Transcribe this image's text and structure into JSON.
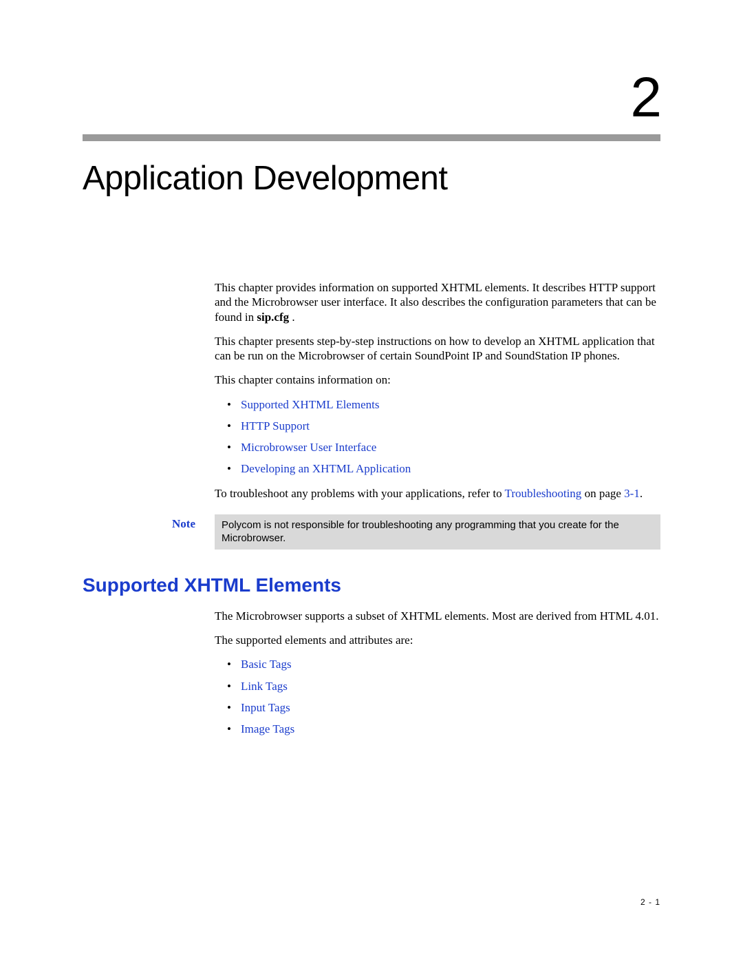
{
  "chapter": {
    "number": "2",
    "title": "Application Development"
  },
  "intro": {
    "p1_a": "This chapter provides information on supported XHTML elements. It describes HTTP support and the Microbrowser user interface. It also describes the configuration parameters that can be found in ",
    "p1_bold": "sip.cfg",
    "p1_b": " .",
    "p2": "This chapter presents step-by-step instructions on how to develop an XHTML application that can be run on the Microbrowser of certain SoundPoint IP and SoundStation IP phones.",
    "p3": "This chapter contains information on:",
    "bullets": [
      "Supported XHTML Elements",
      "HTTP Support",
      "Microbrowser User Interface",
      "Developing an XHTML Application"
    ],
    "p4_a": "To troubleshoot any problems with your applications, refer to ",
    "p4_link": "Troubleshooting",
    "p4_b": " on page ",
    "p4_page": "3-1",
    "p4_c": "."
  },
  "note": {
    "label": "Note",
    "text": "Polycom is not responsible for troubleshooting any programming that you create for the Microbrowser."
  },
  "section": {
    "heading": "Supported XHTML Elements",
    "p1": "The Microbrowser supports a subset of XHTML elements. Most are derived from HTML 4.01.",
    "p2": "The supported elements and attributes are:",
    "bullets": [
      "Basic Tags",
      "Link Tags",
      "Input Tags",
      "Image Tags"
    ]
  },
  "footer": {
    "page": "2 - 1"
  }
}
